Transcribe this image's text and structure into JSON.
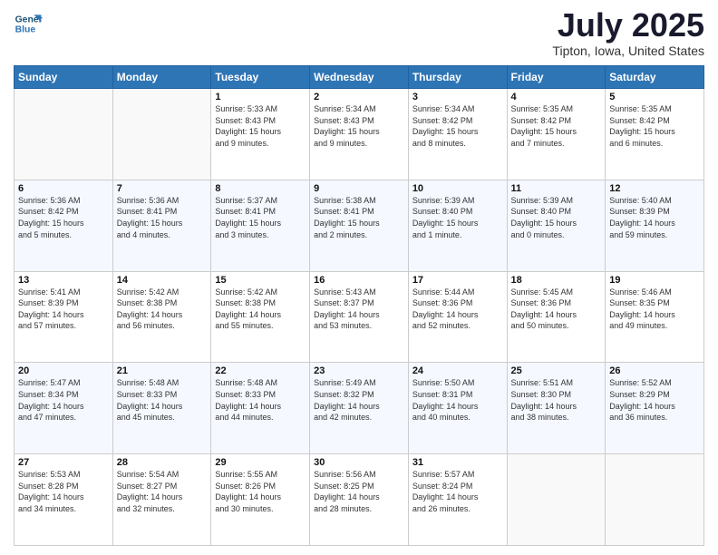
{
  "header": {
    "logo_line1": "General",
    "logo_line2": "Blue",
    "month": "July 2025",
    "location": "Tipton, Iowa, United States"
  },
  "weekdays": [
    "Sunday",
    "Monday",
    "Tuesday",
    "Wednesday",
    "Thursday",
    "Friday",
    "Saturday"
  ],
  "weeks": [
    [
      {
        "day": "",
        "info": ""
      },
      {
        "day": "",
        "info": ""
      },
      {
        "day": "1",
        "info": "Sunrise: 5:33 AM\nSunset: 8:43 PM\nDaylight: 15 hours\nand 9 minutes."
      },
      {
        "day": "2",
        "info": "Sunrise: 5:34 AM\nSunset: 8:43 PM\nDaylight: 15 hours\nand 9 minutes."
      },
      {
        "day": "3",
        "info": "Sunrise: 5:34 AM\nSunset: 8:42 PM\nDaylight: 15 hours\nand 8 minutes."
      },
      {
        "day": "4",
        "info": "Sunrise: 5:35 AM\nSunset: 8:42 PM\nDaylight: 15 hours\nand 7 minutes."
      },
      {
        "day": "5",
        "info": "Sunrise: 5:35 AM\nSunset: 8:42 PM\nDaylight: 15 hours\nand 6 minutes."
      }
    ],
    [
      {
        "day": "6",
        "info": "Sunrise: 5:36 AM\nSunset: 8:42 PM\nDaylight: 15 hours\nand 5 minutes."
      },
      {
        "day": "7",
        "info": "Sunrise: 5:36 AM\nSunset: 8:41 PM\nDaylight: 15 hours\nand 4 minutes."
      },
      {
        "day": "8",
        "info": "Sunrise: 5:37 AM\nSunset: 8:41 PM\nDaylight: 15 hours\nand 3 minutes."
      },
      {
        "day": "9",
        "info": "Sunrise: 5:38 AM\nSunset: 8:41 PM\nDaylight: 15 hours\nand 2 minutes."
      },
      {
        "day": "10",
        "info": "Sunrise: 5:39 AM\nSunset: 8:40 PM\nDaylight: 15 hours\nand 1 minute."
      },
      {
        "day": "11",
        "info": "Sunrise: 5:39 AM\nSunset: 8:40 PM\nDaylight: 15 hours\nand 0 minutes."
      },
      {
        "day": "12",
        "info": "Sunrise: 5:40 AM\nSunset: 8:39 PM\nDaylight: 14 hours\nand 59 minutes."
      }
    ],
    [
      {
        "day": "13",
        "info": "Sunrise: 5:41 AM\nSunset: 8:39 PM\nDaylight: 14 hours\nand 57 minutes."
      },
      {
        "day": "14",
        "info": "Sunrise: 5:42 AM\nSunset: 8:38 PM\nDaylight: 14 hours\nand 56 minutes."
      },
      {
        "day": "15",
        "info": "Sunrise: 5:42 AM\nSunset: 8:38 PM\nDaylight: 14 hours\nand 55 minutes."
      },
      {
        "day": "16",
        "info": "Sunrise: 5:43 AM\nSunset: 8:37 PM\nDaylight: 14 hours\nand 53 minutes."
      },
      {
        "day": "17",
        "info": "Sunrise: 5:44 AM\nSunset: 8:36 PM\nDaylight: 14 hours\nand 52 minutes."
      },
      {
        "day": "18",
        "info": "Sunrise: 5:45 AM\nSunset: 8:36 PM\nDaylight: 14 hours\nand 50 minutes."
      },
      {
        "day": "19",
        "info": "Sunrise: 5:46 AM\nSunset: 8:35 PM\nDaylight: 14 hours\nand 49 minutes."
      }
    ],
    [
      {
        "day": "20",
        "info": "Sunrise: 5:47 AM\nSunset: 8:34 PM\nDaylight: 14 hours\nand 47 minutes."
      },
      {
        "day": "21",
        "info": "Sunrise: 5:48 AM\nSunset: 8:33 PM\nDaylight: 14 hours\nand 45 minutes."
      },
      {
        "day": "22",
        "info": "Sunrise: 5:48 AM\nSunset: 8:33 PM\nDaylight: 14 hours\nand 44 minutes."
      },
      {
        "day": "23",
        "info": "Sunrise: 5:49 AM\nSunset: 8:32 PM\nDaylight: 14 hours\nand 42 minutes."
      },
      {
        "day": "24",
        "info": "Sunrise: 5:50 AM\nSunset: 8:31 PM\nDaylight: 14 hours\nand 40 minutes."
      },
      {
        "day": "25",
        "info": "Sunrise: 5:51 AM\nSunset: 8:30 PM\nDaylight: 14 hours\nand 38 minutes."
      },
      {
        "day": "26",
        "info": "Sunrise: 5:52 AM\nSunset: 8:29 PM\nDaylight: 14 hours\nand 36 minutes."
      }
    ],
    [
      {
        "day": "27",
        "info": "Sunrise: 5:53 AM\nSunset: 8:28 PM\nDaylight: 14 hours\nand 34 minutes."
      },
      {
        "day": "28",
        "info": "Sunrise: 5:54 AM\nSunset: 8:27 PM\nDaylight: 14 hours\nand 32 minutes."
      },
      {
        "day": "29",
        "info": "Sunrise: 5:55 AM\nSunset: 8:26 PM\nDaylight: 14 hours\nand 30 minutes."
      },
      {
        "day": "30",
        "info": "Sunrise: 5:56 AM\nSunset: 8:25 PM\nDaylight: 14 hours\nand 28 minutes."
      },
      {
        "day": "31",
        "info": "Sunrise: 5:57 AM\nSunset: 8:24 PM\nDaylight: 14 hours\nand 26 minutes."
      },
      {
        "day": "",
        "info": ""
      },
      {
        "day": "",
        "info": ""
      }
    ]
  ]
}
